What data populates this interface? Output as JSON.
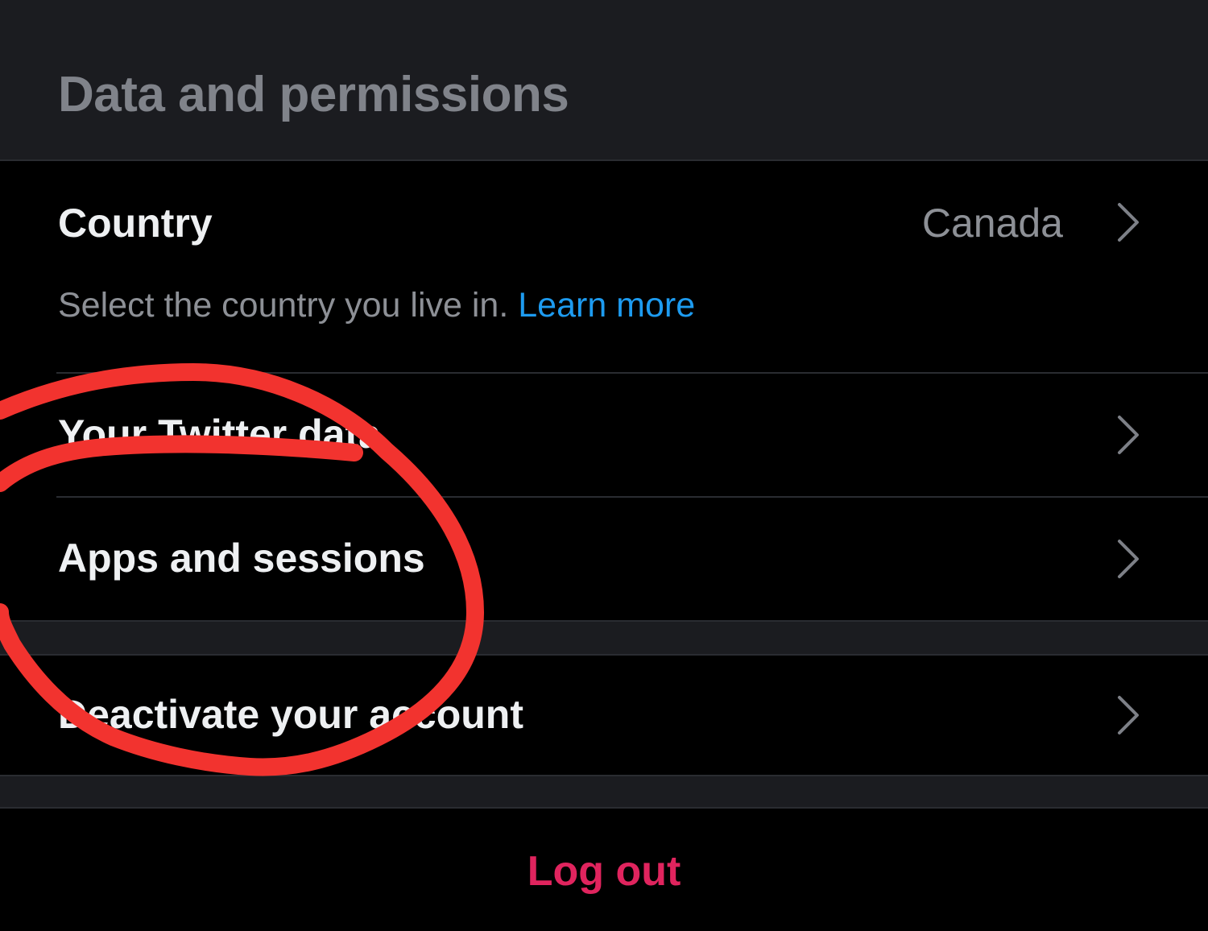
{
  "section": {
    "title": "Data and permissions"
  },
  "country": {
    "label": "Country",
    "value": "Canada",
    "description": "Select the country you live in.",
    "learn_more": "Learn more"
  },
  "items": [
    {
      "label": "Your Twitter data"
    },
    {
      "label": "Apps and sessions"
    },
    {
      "label": "Deactivate your account"
    }
  ],
  "logout": {
    "label": "Log out"
  },
  "colors": {
    "background": "#000000",
    "header_background": "#1b1c20",
    "link": "#1d9bf0",
    "logout": "#e0245e",
    "annotation": "#f2332f"
  },
  "icons": {
    "chevron": "chevron-right-icon"
  }
}
